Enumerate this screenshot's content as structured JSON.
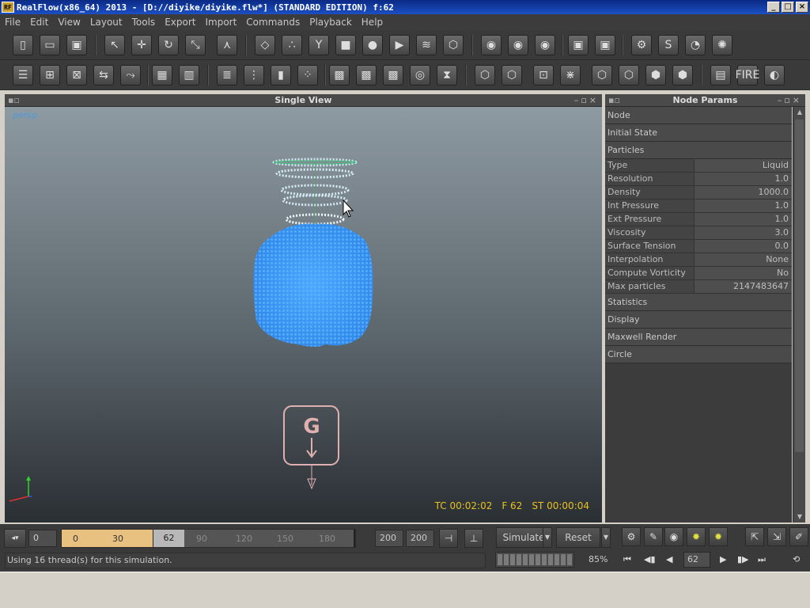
{
  "window": {
    "title": "RealFlow(x86_64) 2013 - [D://diyike/diyike.flw*] (STANDARD EDITION) f:62",
    "app_icon_label": "RF",
    "controls": {
      "minimize": "_",
      "maximize": "□",
      "close": "×"
    }
  },
  "menu": [
    "File",
    "Edit",
    "View",
    "Layout",
    "Tools",
    "Export",
    "Import",
    "Commands",
    "Playback",
    "Help"
  ],
  "viewport": {
    "header": "Single View",
    "camera": "persp",
    "hud": {
      "timecode": "TC 00:02:02",
      "frame": "F 62",
      "sim_time": "ST 00:00:04"
    },
    "gravity_label": "G"
  },
  "node_params": {
    "header": "Node Params",
    "sections_top": [
      "Node",
      "Initial State",
      "Particles"
    ],
    "particles": [
      {
        "key": "Type",
        "value": "Liquid"
      },
      {
        "key": "Resolution",
        "value": "1.0"
      },
      {
        "key": "Density",
        "value": "1000.0"
      },
      {
        "key": "Int Pressure",
        "value": "1.0"
      },
      {
        "key": "Ext Pressure",
        "value": "1.0"
      },
      {
        "key": "Viscosity",
        "value": "3.0"
      },
      {
        "key": "Surface Tension",
        "value": "0.0"
      },
      {
        "key": "Interpolation",
        "value": "None"
      },
      {
        "key": "Compute Vorticity",
        "value": "No"
      },
      {
        "key": "Max particles",
        "value": "2147483647"
      }
    ],
    "sections_bottom": [
      "Statistics",
      "Display",
      "Maxwell Render",
      "Circle"
    ]
  },
  "timeline": {
    "start_field": "0",
    "labels": [
      "0",
      "30",
      "90",
      "120",
      "150",
      "180"
    ],
    "current_frame": "62",
    "end_field_1": "200",
    "end_field_2": "200",
    "played_fraction": 0.31
  },
  "controls": {
    "simulate": "Simulate",
    "reset": "Reset",
    "progress_percent": "85%",
    "frame_field": "62"
  },
  "status": {
    "message": "Using 16 thread(s) for this simulation."
  }
}
